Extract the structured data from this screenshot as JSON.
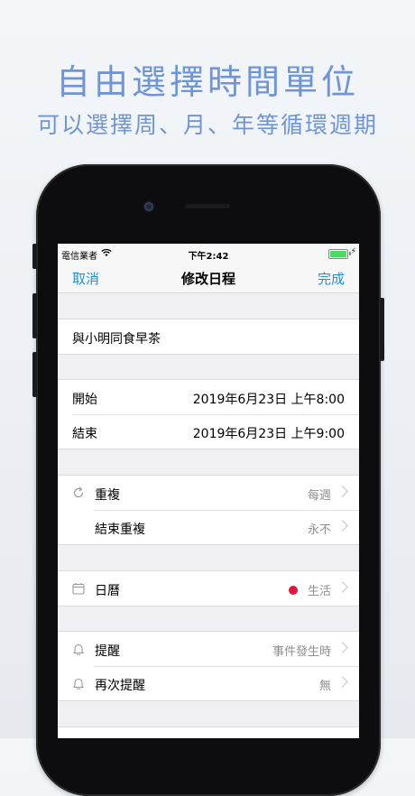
{
  "promo": {
    "headline": "自由選擇時間單位",
    "subline": "可以選擇周、月、年等循環週期"
  },
  "status_bar": {
    "carrier": "電信業者",
    "time": "下午2:42"
  },
  "nav": {
    "cancel": "取消",
    "title": "修改日程",
    "done": "完成",
    "accent_color": "#1e90d8"
  },
  "event": {
    "title": "與小明同食早茶"
  },
  "time": {
    "start_label": "開始",
    "start_value": "2019年6月23日 上午8:00",
    "end_label": "結束",
    "end_value": "2019年6月23日 上午9:00"
  },
  "repeat": {
    "repeat_label": "重複",
    "repeat_value": "每週",
    "end_repeat_label": "結束重複",
    "end_repeat_value": "永不",
    "icon": "repeat-icon"
  },
  "calendar": {
    "label": "日曆",
    "value": "生活",
    "dot_color": "#e0163a",
    "icon": "calendar-icon"
  },
  "alerts": {
    "alert_label": "提醒",
    "alert_value": "事件發生時",
    "second_alert_label": "再次提醒",
    "second_alert_value": "無",
    "icon": "bell-icon"
  }
}
